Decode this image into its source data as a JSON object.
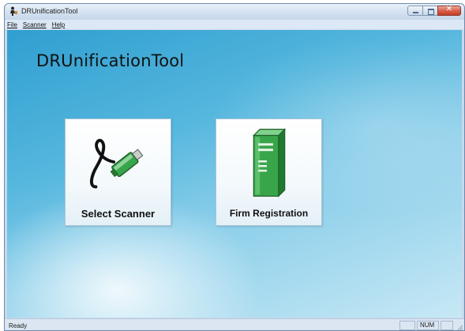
{
  "window": {
    "title": "DRUnificationTool",
    "caption_buttons": {
      "minimize_icon": "minimize-icon",
      "maximize_icon": "maximize-icon",
      "close_glyph": "✕"
    }
  },
  "menubar": {
    "items": [
      {
        "label": "File"
      },
      {
        "label": "Scanner"
      },
      {
        "label": "Help"
      }
    ]
  },
  "main": {
    "heading": "DRUnificationTool",
    "tiles": [
      {
        "label": "Select Scanner",
        "icon": "scanner-cable-icon"
      },
      {
        "label": "Firm Registration",
        "icon": "server-icon"
      }
    ]
  },
  "statusbar": {
    "status": "Ready",
    "num_indicator": "NUM"
  },
  "colors": {
    "background_gradient_start": "#2f9fd0",
    "background_gradient_end": "#c7e8f5",
    "icon_green": "#2a9a3c",
    "close_red": "#c33c22"
  }
}
